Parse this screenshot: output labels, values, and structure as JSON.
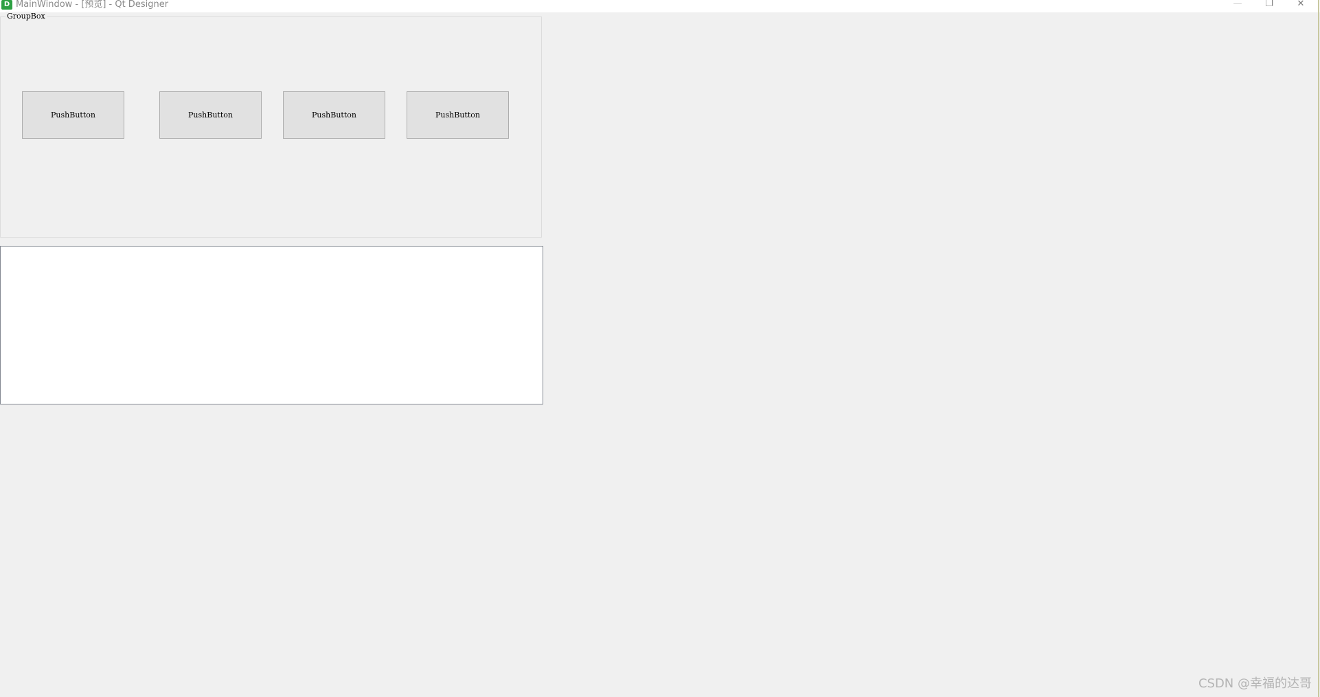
{
  "window": {
    "title": "MainWindow - [预览] - Qt Designer",
    "app_icon_letter": "D",
    "controls": {
      "minimize": "—",
      "restore": "❐",
      "close": "✕"
    }
  },
  "groupbox": {
    "title": "GroupBox",
    "buttons": [
      "PushButton",
      "PushButton",
      "PushButton",
      "PushButton"
    ]
  },
  "textedit": {
    "value": ""
  },
  "watermark": "CSDN @幸福的达哥"
}
